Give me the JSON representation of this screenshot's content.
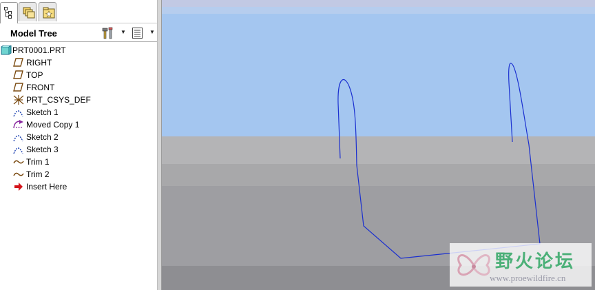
{
  "left_tabs": [
    {
      "name": "model-tree-tab",
      "icon": "tree-structure-icon",
      "active": true
    },
    {
      "name": "folder-browser-tab",
      "icon": "folder-stack-icon",
      "active": false
    },
    {
      "name": "favorites-tab",
      "icon": "favorites-folder-icon",
      "active": false
    }
  ],
  "tree_header": {
    "title": "Model Tree",
    "settings_icon": "tools-settings-icon",
    "show_icon": "tree-columns-icon"
  },
  "tree": {
    "items": [
      {
        "label": "PRT0001.PRT",
        "icon": "part-icon"
      },
      {
        "label": "RIGHT",
        "icon": "datum-plane-icon"
      },
      {
        "label": "TOP",
        "icon": "datum-plane-icon"
      },
      {
        "label": "FRONT",
        "icon": "datum-plane-icon"
      },
      {
        "label": "PRT_CSYS_DEF",
        "icon": "coordinate-system-icon"
      },
      {
        "label": "Sketch 1",
        "icon": "sketch-icon"
      },
      {
        "label": "Moved Copy 1",
        "icon": "moved-copy-icon"
      },
      {
        "label": "Sketch 2",
        "icon": "sketch-icon"
      },
      {
        "label": "Sketch 3",
        "icon": "sketch-icon"
      },
      {
        "label": "Trim 1",
        "icon": "curve-trim-icon"
      },
      {
        "label": "Trim 2",
        "icon": "curve-trim-icon"
      },
      {
        "label": "Insert Here",
        "icon": "insert-arrow-icon"
      }
    ]
  },
  "viewport": {
    "sky_color": "#a4c6f0",
    "curve_color": "#1a2fd0"
  },
  "watermark": {
    "cn_text": "野火论坛",
    "url": "www.proewildfire.cn"
  }
}
